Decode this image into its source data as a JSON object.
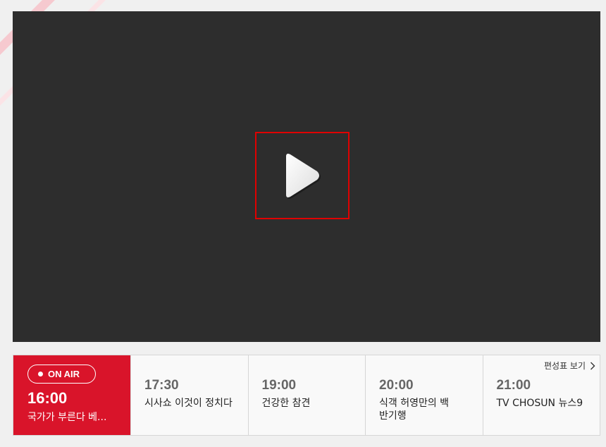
{
  "player": {
    "play_icon": "play-icon"
  },
  "schedule": {
    "onair": {
      "badge": "ON AIR",
      "time": "16:00",
      "title": "국가가 부른다 베..."
    },
    "link_label": "편성표 보기",
    "link_icon": "chevron-right-icon",
    "items": [
      {
        "time": "17:30",
        "title": "시사쇼 이것이 정치다"
      },
      {
        "time": "19:00",
        "title": "건강한 참견"
      },
      {
        "time": "20:00",
        "title": "식객 허영만의 백반기행"
      },
      {
        "time": "21:00",
        "title": "TV CHOSUN 뉴스9"
      }
    ],
    "colors": {
      "onair_bg": "#d9142a",
      "player_bg": "#2d2d2d"
    }
  }
}
